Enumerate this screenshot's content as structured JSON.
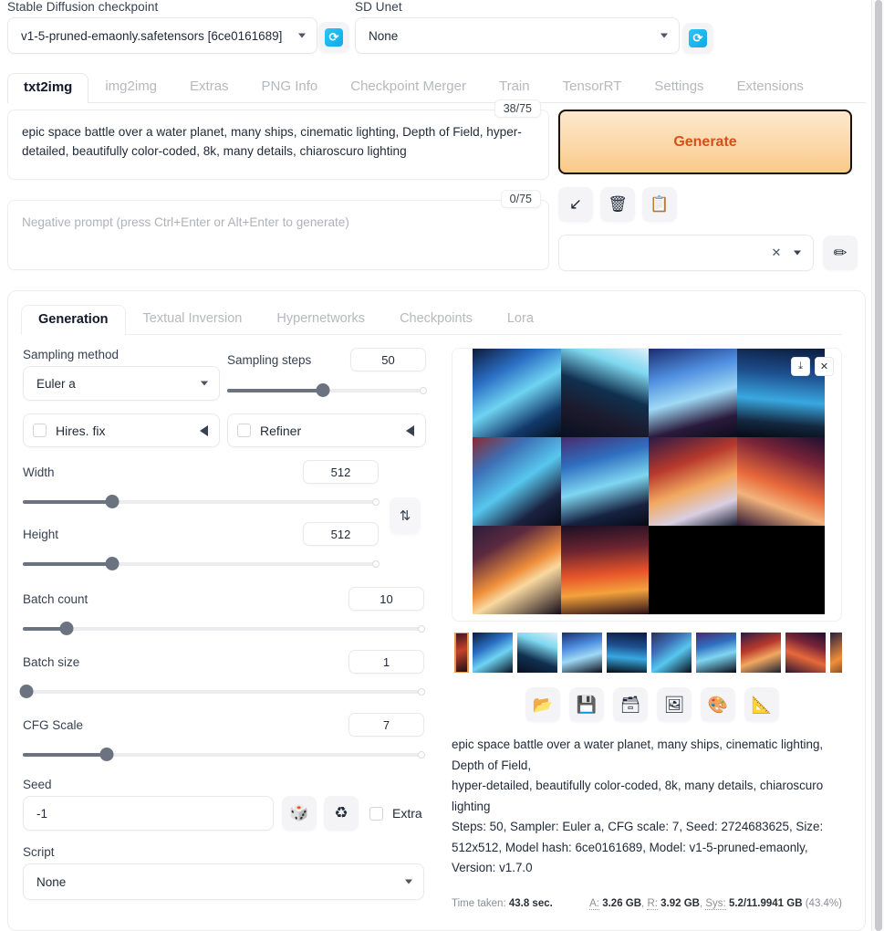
{
  "topbar": {
    "checkpoint_label": "Stable Diffusion checkpoint",
    "checkpoint_value": "v1-5-pruned-emaonly.safetensors [6ce0161689]",
    "unet_label": "SD Unet",
    "unet_value": "None",
    "refresh_icon": "refresh-icon"
  },
  "main_tabs": [
    {
      "label": "txt2img",
      "active": true
    },
    {
      "label": "img2img",
      "active": false
    },
    {
      "label": "Extras",
      "active": false
    },
    {
      "label": "PNG Info",
      "active": false
    },
    {
      "label": "Checkpoint Merger",
      "active": false
    },
    {
      "label": "Train",
      "active": false
    },
    {
      "label": "TensorRT",
      "active": false
    },
    {
      "label": "Settings",
      "active": false
    },
    {
      "label": "Extensions",
      "active": false
    }
  ],
  "prompt": {
    "positive_value": "epic space battle over a water planet, many ships, cinematic lighting, Depth of Field, hyper-detailed, beautifully color-coded, 8k, many details, chiaroscuro lighting",
    "positive_tokens": "38/75",
    "negative_placeholder": "Negative prompt (press Ctrl+Enter or Alt+Enter to generate)",
    "negative_value": "",
    "negative_tokens": "0/75"
  },
  "generate": {
    "label": "Generate",
    "accent_color": "#d94f19",
    "small_buttons": [
      {
        "name": "paste-arrow-button",
        "glyph": "↙"
      },
      {
        "name": "clear-prompt-button",
        "glyph": "🗑"
      },
      {
        "name": "apply-style-button",
        "glyph": "📋"
      }
    ],
    "styles_value": "",
    "styles_clear_glyph": "✕",
    "edit_styles_glyph": "✏"
  },
  "sub_tabs": [
    {
      "label": "Generation",
      "active": true
    },
    {
      "label": "Textual Inversion",
      "active": false
    },
    {
      "label": "Hypernetworks",
      "active": false
    },
    {
      "label": "Checkpoints",
      "active": false
    },
    {
      "label": "Lora",
      "active": false
    }
  ],
  "controls": {
    "sampling_method_label": "Sampling method",
    "sampling_method_value": "Euler a",
    "sampling_steps_label": "Sampling steps",
    "sampling_steps_value": "50",
    "sampling_steps_pct": 48,
    "hires_fix_label": "Hires. fix",
    "hires_fix_checked": false,
    "refiner_label": "Refiner",
    "refiner_checked": false,
    "width_label": "Width",
    "width_value": "512",
    "width_pct": 25,
    "height_label": "Height",
    "height_value": "512",
    "height_pct": 25,
    "swap_glyph": "⇅",
    "batch_count_label": "Batch count",
    "batch_count_value": "10",
    "batch_count_pct": 11,
    "batch_size_label": "Batch size",
    "batch_size_value": "1",
    "batch_size_pct": 1,
    "cfg_scale_label": "CFG Scale",
    "cfg_scale_value": "7",
    "cfg_scale_pct": 21,
    "seed_label": "Seed",
    "seed_value": "-1",
    "seed_random_glyph": "🎲",
    "seed_recycle_glyph": "♻",
    "extra_label": "Extra",
    "extra_checked": false,
    "script_label": "Script",
    "script_value": "None"
  },
  "results": {
    "download_glyph": "⤓",
    "close_glyph": "✕",
    "action_buttons": [
      {
        "name": "open-folder-button",
        "glyph": "📂"
      },
      {
        "name": "save-button",
        "glyph": "💾"
      },
      {
        "name": "save-zip-button",
        "glyph": "🗃"
      },
      {
        "name": "send-to-img2img-button",
        "glyph": "🖼"
      },
      {
        "name": "send-to-inpaint-button",
        "glyph": "🎨"
      },
      {
        "name": "send-to-extras-button",
        "glyph": "📐"
      }
    ],
    "info_prompt_line1": "epic space battle over a water planet, many ships, cinematic lighting,",
    "info_prompt_line2": "Depth of Field,",
    "info_prompt_line3": "hyper-detailed, beautifully color-coded, 8k, many details, chiaroscuro",
    "info_prompt_line4": "lighting",
    "info_params_line1": "Steps: 50, Sampler: Euler a, CFG scale: 7, Seed: 2724683625, Size:",
    "info_params_line2": "512x512, Model hash: 6ce0161689, Model: v1-5-pruned-emaonly,",
    "info_params_line3": "Version: v1.7.0",
    "time_taken_label": "Time taken:",
    "time_taken_value": "43.8 sec.",
    "mem_a_label": "A:",
    "mem_a_value": "3.26 GB",
    "mem_r_label": "R:",
    "mem_r_value": "3.92 GB",
    "mem_sys_label": "Sys:",
    "mem_sys_value": "5.2/11.9941 GB",
    "mem_sys_pct": "(43.4%)"
  }
}
